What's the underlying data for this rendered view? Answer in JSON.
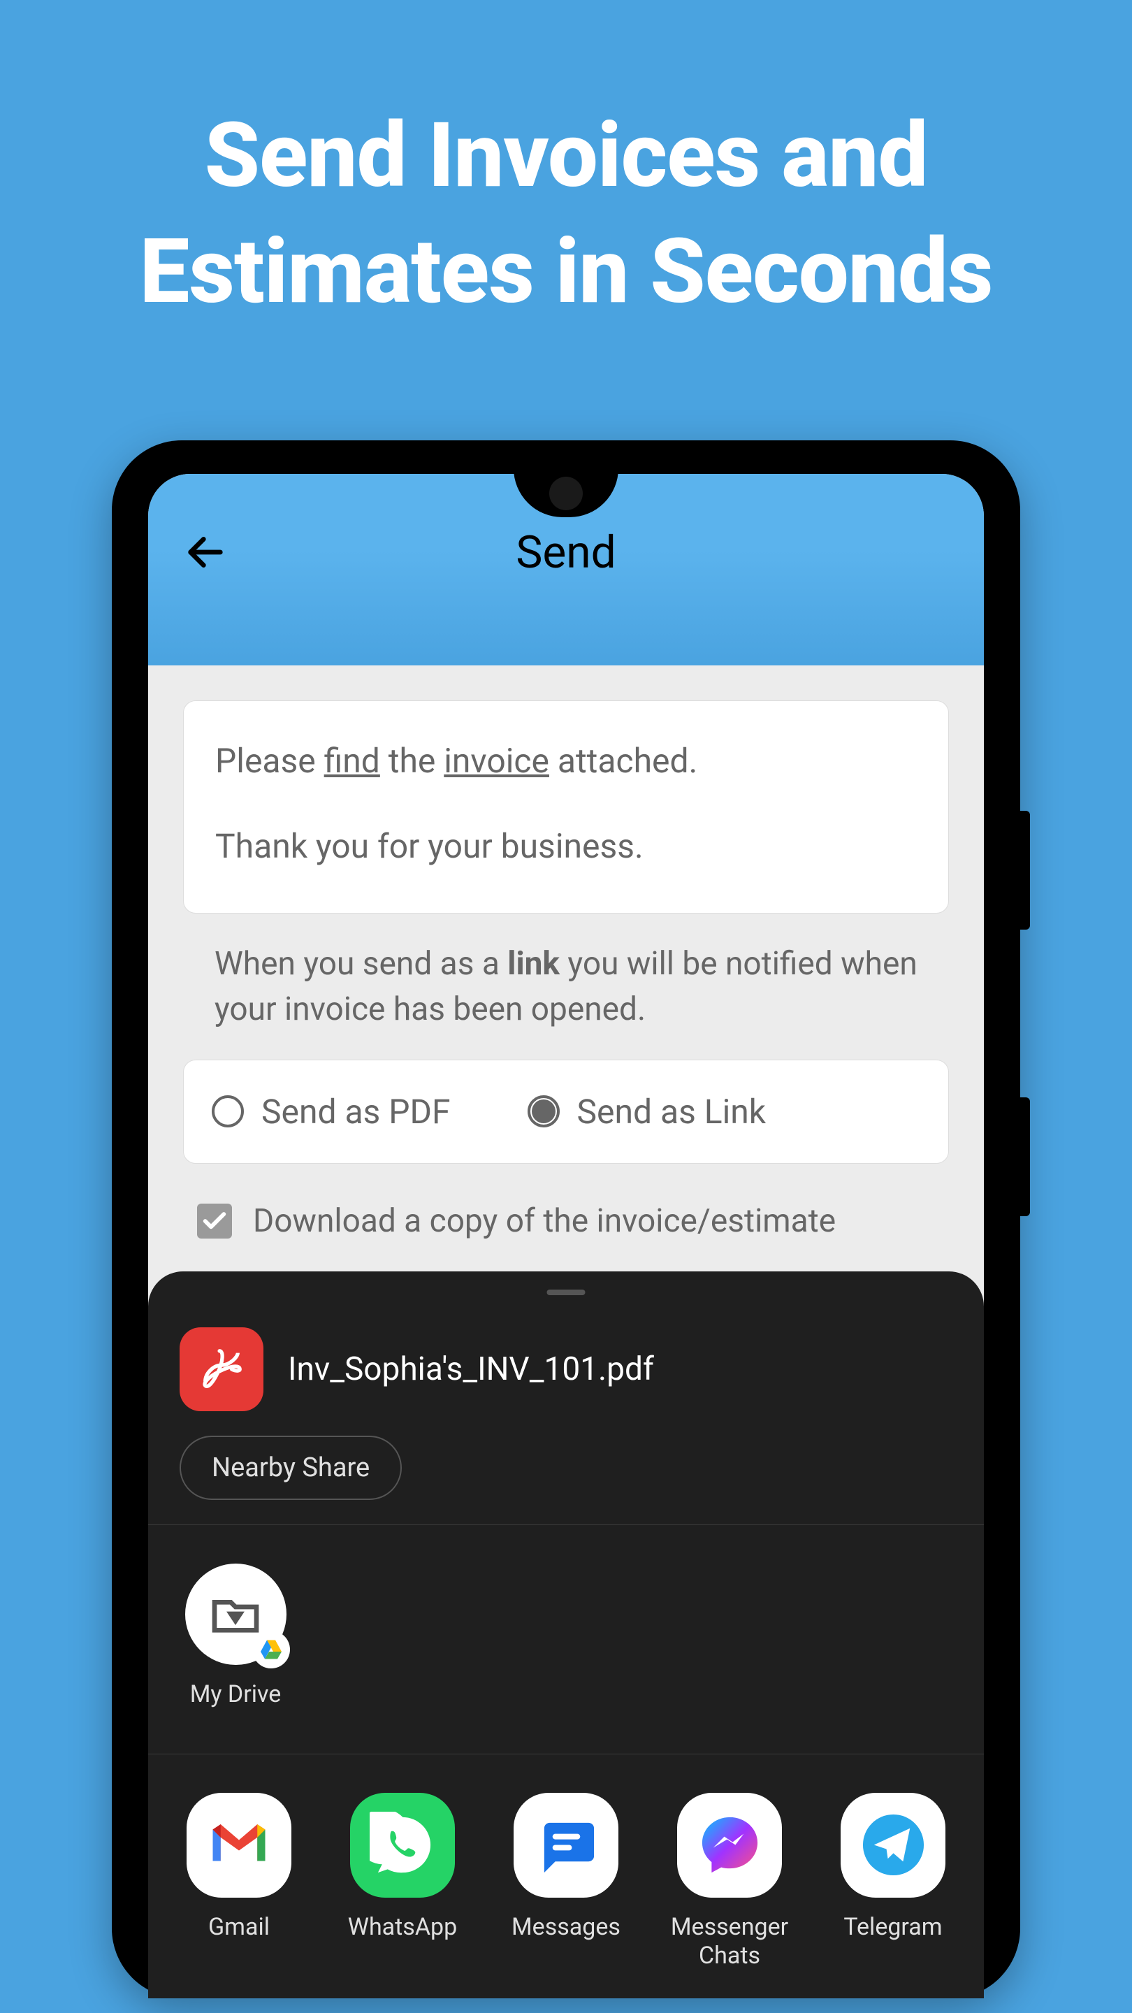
{
  "page": {
    "title": "Send Invoices and Estimates in Seconds"
  },
  "header": {
    "title": "Send"
  },
  "message": {
    "line1_prefix": "Please ",
    "line1_find": "find",
    "line1_mid": " the ",
    "line1_invoice": "invoice",
    "line1_suffix": " attached.",
    "line2": "Thank you for your business."
  },
  "notify": {
    "prefix": "When you send as a ",
    "link_word": "link",
    "suffix": " you will be notified when your invoice has been opened."
  },
  "options": {
    "pdf_label": "Send as PDF",
    "link_label": "Send as Link",
    "selected": "link"
  },
  "checkbox": {
    "label": "Download a copy of the invoice/estimate",
    "checked": true
  },
  "share": {
    "file_name": "Inv_Sophia's_INV_101.pdf",
    "nearby_label": "Nearby Share",
    "drive_label": "My Drive",
    "apps": [
      {
        "label": "Gmail"
      },
      {
        "label": "WhatsApp"
      },
      {
        "label": "Messages"
      },
      {
        "label": "Messenger Chats"
      },
      {
        "label": "Telegram"
      }
    ]
  }
}
